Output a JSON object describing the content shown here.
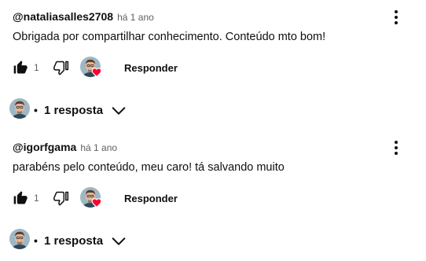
{
  "comments": [
    {
      "author": "@nataliasalles2708",
      "time": "há 1 ano",
      "text": "Obrigada por compartilhar conhecimento. Conteúdo mto bom!",
      "likes": "1",
      "reply_label": "Responder",
      "replies_dot": "•",
      "replies_label": "1 resposta"
    },
    {
      "author": "@igorfgama",
      "time": "há 1 ano",
      "text": "parabéns pelo conteúdo, meu caro! tá salvando muito",
      "likes": "1",
      "reply_label": "Responder",
      "replies_dot": "•",
      "replies_label": "1 resposta"
    }
  ],
  "icons": {
    "like": "thumb-up-filled-icon",
    "dislike": "thumb-down-outline-icon",
    "creator_heart": "creator-heart-icon",
    "more": "more-vertical-icon",
    "expand": "chevron-down-icon"
  },
  "colors": {
    "heart": "#ff0033",
    "text_primary": "#0f0f0f",
    "text_secondary": "#606060"
  }
}
